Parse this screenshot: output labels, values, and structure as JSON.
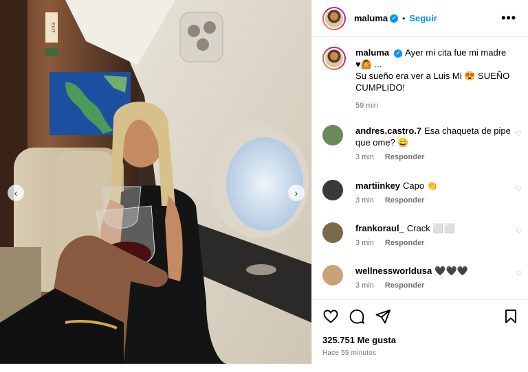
{
  "post": {
    "author": "maluma",
    "follow_label": "Seguir",
    "separator": "•",
    "more_label": "•••",
    "verified_mark": "✔",
    "caption": {
      "user": "maluma",
      "line1": "Ayer mi cita fue mi madre",
      "line2": "♥🙆 ...",
      "line3": "Su sueño era ver a Luis Mi 😍 SUEÑO CUMPLIDO!",
      "time": "59 min"
    },
    "comments": [
      {
        "user": "andres.castro.7",
        "text": "Esa chaqueta de pipe que ome? 😄",
        "time": "3 min",
        "reply": "Responder",
        "avatar_color": "#6b8a5a"
      },
      {
        "user": "martiinkey",
        "text": "Capo 👏",
        "time": "3 min",
        "reply": "Responder",
        "avatar_color": "#3a3a3a"
      },
      {
        "user": "frankoraul_",
        "text": "Crack ⬜⬜",
        "time": "3 min",
        "reply": "Responder",
        "avatar_color": "#7a6a4a"
      },
      {
        "user": "wellnessworldusa",
        "text": "🖤🖤🖤",
        "time": "3 min",
        "reply": "Responder",
        "avatar_color": "#c9a27a"
      }
    ],
    "likes": "325.751 Me gusta",
    "posted": "Hace 59 minutos"
  },
  "media": {
    "prev_icon": "‹",
    "next_icon": "›",
    "exit_sign": "EXIT"
  },
  "icons": {
    "like": "heart-icon",
    "comment": "comment-icon",
    "share": "share-icon",
    "save": "bookmark-icon"
  },
  "colors": {
    "accent": "#0095f6",
    "muted": "#737373",
    "divider": "#efefef"
  }
}
